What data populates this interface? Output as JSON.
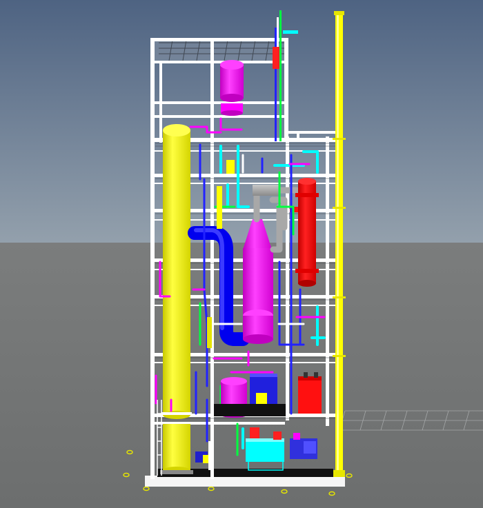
{
  "scene": {
    "colors": {
      "sky_top": "#4e6382",
      "sky_horizon": "#93a0ac",
      "ground_top": "#7b7d7d",
      "ground_bottom": "#6c6e6e",
      "steel_frame": "#ffffff",
      "grating": "#9aa0a8",
      "column": "#ffff00",
      "flare_stack": "#ffff00",
      "vessel": "#ff00ff",
      "exchanger": "#ff0000",
      "duct": "#0000ee",
      "pipe_cyan": "#00ffff",
      "pipe_green": "#00ff40",
      "pipe_grey": "#a8a8a8",
      "pump_skid": "#00ffff",
      "base_slab": "#111111",
      "foundation": "#f5f5f5"
    },
    "equipment": [
      {
        "name": "distillation-column",
        "color": "yellow"
      },
      {
        "name": "top-vessel",
        "color": "magenta"
      },
      {
        "name": "cone-vessel",
        "color": "magenta"
      },
      {
        "name": "heat-exchanger",
        "color": "red"
      },
      {
        "name": "blue-duct",
        "color": "blue"
      },
      {
        "name": "bottom-tank",
        "color": "magenta"
      },
      {
        "name": "control-cabinet",
        "color": "blue"
      },
      {
        "name": "red-cabinet",
        "color": "red"
      },
      {
        "name": "pump-skid",
        "color": "cyan"
      },
      {
        "name": "flare-stack",
        "color": "yellow"
      }
    ]
  }
}
